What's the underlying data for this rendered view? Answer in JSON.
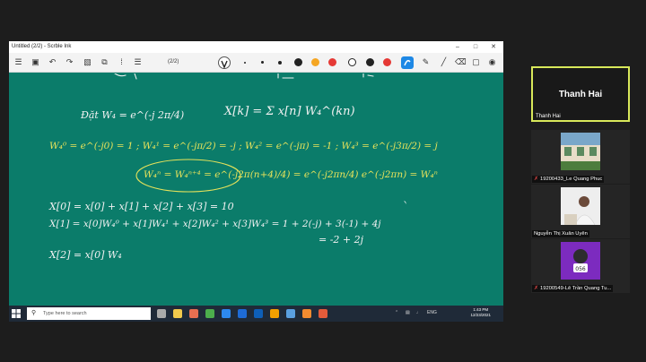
{
  "window": {
    "title": "Untitled (2/2) - Scrble Ink",
    "minimize": "–",
    "maximize": "□",
    "close": "✕"
  },
  "toolbar": {
    "page_indicator": "(2/2)",
    "pen_colors": [
      "#222222",
      "#f5a623",
      "#e53935",
      "#222222",
      "#ffffff",
      "#222222",
      "#e53935"
    ]
  },
  "board": {
    "background": "#0b7c6a",
    "ink_white": "#f2f2f2",
    "ink_yellow": "#e8e35a",
    "lines": [
      "Đặt  W₄ = e^(-j 2π/4)",
      "X[k] = Σ x[n] W₄^(kn)",
      "W₄⁰ = e^(-j0) = 1 ;  W₄¹ = e^(-jπ/2) = -j ;  W₄² = e^(-jπ) = -1 ;  W₄³ = e^(-j3π/2) = j",
      "W₄ⁿ = W₄ⁿ⁺⁴ = e^(-j2π(n+4)/4) = e^(-j2πn/4) e^(-j2πn) = W₄ⁿ",
      "X[0] = x[0] + x[1] + x[2] + x[3] = 10",
      "X[1] = x[0]W₄⁰ + x[1]W₄¹ + x[2]W₄² + x[3]W₄³ = 1 + 2(-j) + 3(-1) + 4j",
      "= -2 + 2j",
      "X[2] = x[0] W₄"
    ]
  },
  "taskbar": {
    "search_placeholder": "Type here to search",
    "time": "1:43 PM",
    "date": "12/23/2021",
    "lang": "ENG",
    "app_colors": [
      "#f2c94c",
      "#e76f51",
      "#4cae4c",
      "#2d89ef",
      "#1e6bd6",
      "#0e5fb8",
      "#f4a100",
      "#5aa0e0",
      "#f28b30",
      "#e35b3a"
    ]
  },
  "participants": {
    "active": {
      "name": "Thanh Hai",
      "label": "Thanh Hai"
    },
    "others": [
      {
        "label": "19200433_Le Quang Phuc"
      },
      {
        "label": "Nguyễn Thị Xuân Uyên"
      },
      {
        "label": "19200549-Lê Trần Quang Tu..."
      }
    ],
    "avatar3_badge": "056"
  }
}
